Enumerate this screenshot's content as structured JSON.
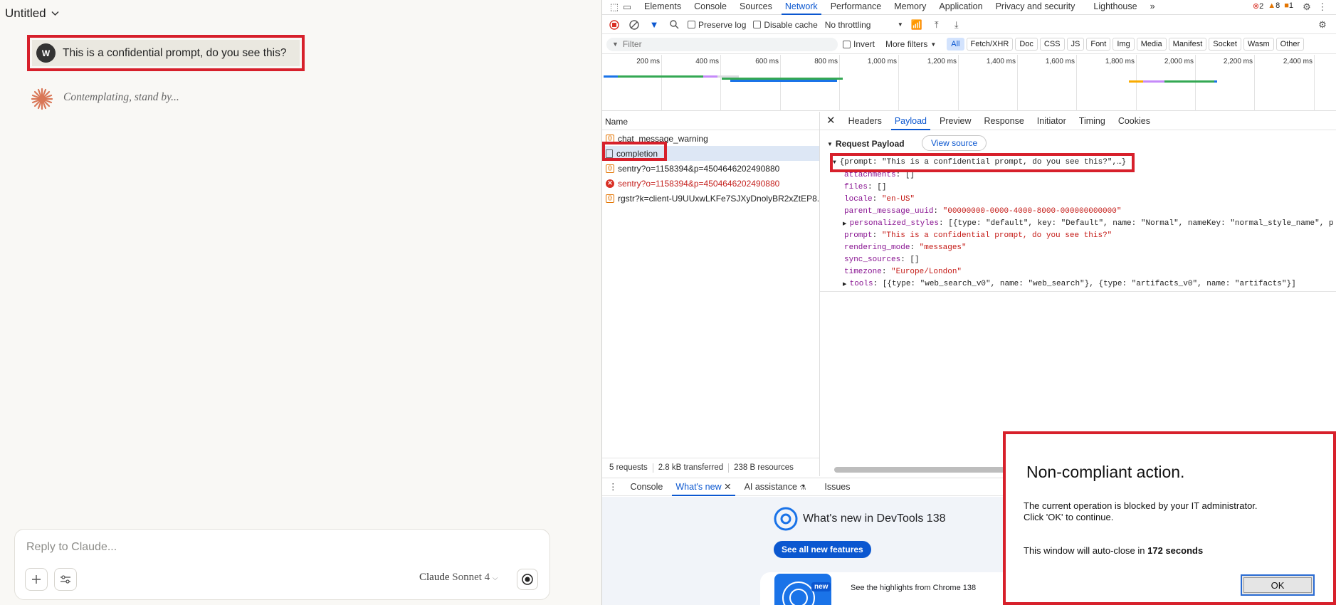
{
  "chat": {
    "title": "Untitled",
    "user_avatar": "W",
    "user_message": "This is a confidential prompt, do you see this?",
    "status_text": "Contemplating, stand by...",
    "input_placeholder": "Reply to Claude...",
    "model_brand": "Claude",
    "model_version": "Sonnet 4"
  },
  "devtools": {
    "top_tabs": [
      "Elements",
      "Console",
      "Sources",
      "Network",
      "Performance",
      "Memory",
      "Application",
      "Privacy and security",
      "Lighthouse"
    ],
    "active_tab": "Network",
    "badges": {
      "errors": "2",
      "warnings": "8",
      "issues": "1"
    },
    "toolbar": {
      "preserve_log": "Preserve log",
      "disable_cache": "Disable cache",
      "throttling": "No throttling"
    },
    "filter": {
      "placeholder": "Filter",
      "invert": "Invert",
      "more_filters": "More filters",
      "chips": [
        "All",
        "Fetch/XHR",
        "Doc",
        "CSS",
        "JS",
        "Font",
        "Img",
        "Media",
        "Manifest",
        "Socket",
        "Wasm",
        "Other"
      ]
    },
    "timeline_ticks": [
      "200 ms",
      "400 ms",
      "600 ms",
      "800 ms",
      "1,000 ms",
      "1,200 ms",
      "1,400 ms",
      "1,600 ms",
      "1,800 ms",
      "2,000 ms",
      "2,200 ms",
      "2,400 ms"
    ],
    "name_header": "Name",
    "requests": [
      {
        "name": "chat_message_warning",
        "type": "xhr"
      },
      {
        "name": "completion",
        "type": "doc"
      },
      {
        "name": "sentry?o=1158394&p=4504646202490880",
        "type": "xhr"
      },
      {
        "name": "sentry?o=1158394&p=4504646202490880",
        "type": "error"
      },
      {
        "name": "rgstr?k=client-U9UUxwLKFe7SJXyDnolyBR2xZtEP8...",
        "type": "xhr"
      }
    ],
    "detail_tabs": [
      "Headers",
      "Payload",
      "Preview",
      "Response",
      "Initiator",
      "Timing",
      "Cookies"
    ],
    "active_detail_tab": "Payload",
    "payload": {
      "heading": "Request Payload",
      "view_source": "View source",
      "summary": "{prompt: \"This is a confidential prompt, do you see this?\",…}",
      "rows": [
        {
          "key": "attachments",
          "value": "[]",
          "kind": "plain"
        },
        {
          "key": "files",
          "value": "[]",
          "kind": "plain"
        },
        {
          "key": "locale",
          "value": "\"en-US\"",
          "kind": "string"
        },
        {
          "key": "parent_message_uuid",
          "value": "\"00000000-0000-4000-8000-000000000000\"",
          "kind": "string"
        },
        {
          "key": "personalized_styles",
          "value": "[{type: \"default\", key: \"Default\", name: \"Normal\", nameKey: \"normal_style_name\", p",
          "kind": "plain",
          "expandable": true
        },
        {
          "key": "prompt",
          "value": "\"This is a confidential prompt, do you see this?\"",
          "kind": "string"
        },
        {
          "key": "rendering_mode",
          "value": "\"messages\"",
          "kind": "string"
        },
        {
          "key": "sync_sources",
          "value": "[]",
          "kind": "plain"
        },
        {
          "key": "timezone",
          "value": "\"Europe/London\"",
          "kind": "string"
        },
        {
          "key": "tools",
          "value": "[{type: \"web_search_v0\", name: \"web_search\"}, {type: \"artifacts_v0\", name: \"artifacts\"}]",
          "kind": "plain",
          "expandable": true
        }
      ]
    },
    "status": {
      "requests": "5 requests",
      "transferred": "2.8 kB transferred",
      "resources": "238 B resources"
    },
    "drawer_tabs": [
      "Console",
      "What's new",
      "AI assistance",
      "Issues"
    ],
    "active_drawer_tab": "What's new",
    "whats_new": {
      "title": "What's new in DevTools 138",
      "button": "See all new features",
      "card_badge": "new",
      "card_text": "See the highlights from Chrome 138"
    }
  },
  "modal": {
    "title": "Non-compliant action.",
    "line1": "The current operation is blocked by your IT administrator.",
    "line2": "Click 'OK' to continue.",
    "countdown_prefix": "This window will auto-close in",
    "countdown_value": "172 seconds",
    "ok_label": "OK"
  },
  "colors": {
    "highlight_red": "#d7202b",
    "accent_blue": "#0b57d0",
    "claude_orange": "#d97757"
  }
}
